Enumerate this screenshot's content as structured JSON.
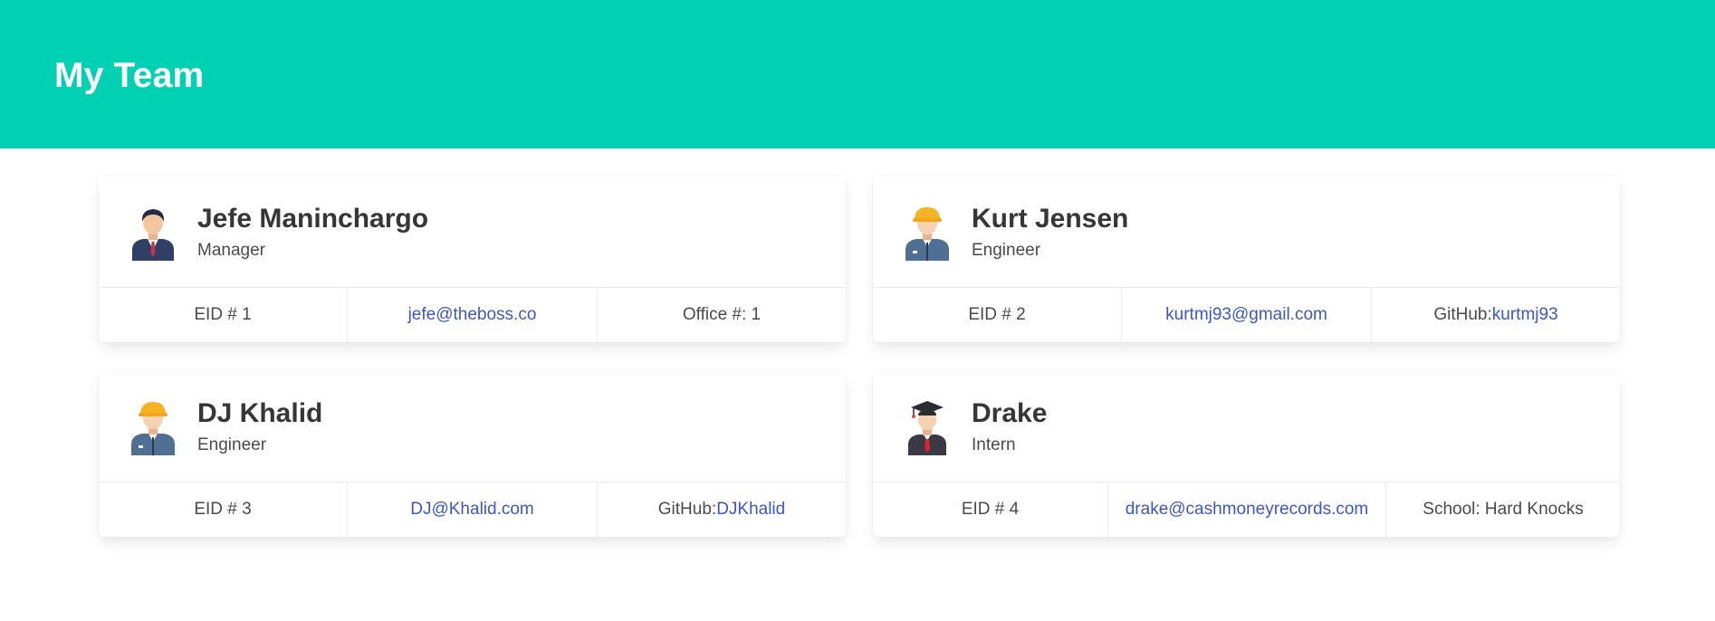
{
  "header": {
    "title": "My Team",
    "accent_color": "#00d1b2"
  },
  "link_color": "#3e56c4",
  "members": [
    {
      "name": "Jefe Maninchargo",
      "role": "Manager",
      "avatar_icon": "manager-avatar-icon",
      "eid": "EID # 1",
      "email": "jefe@theboss.co",
      "extra_prefix": "Office #: 1",
      "extra_link": ""
    },
    {
      "name": "Kurt Jensen",
      "role": "Engineer",
      "avatar_icon": "engineer-avatar-icon",
      "eid": "EID # 2",
      "email": "kurtmj93@gmail.com",
      "extra_prefix": "GitHub:",
      "extra_link": "kurtmj93"
    },
    {
      "name": "DJ Khalid",
      "role": "Engineer",
      "avatar_icon": "engineer-avatar-icon",
      "eid": "EID # 3",
      "email": "DJ@Khalid.com",
      "extra_prefix": "GitHub:",
      "extra_link": "DJKhalid"
    },
    {
      "name": "Drake",
      "role": "Intern",
      "avatar_icon": "intern-avatar-icon",
      "eid": "EID # 4",
      "email": "drake@cashmoneyrecords.com",
      "extra_prefix": "School: Hard Knocks",
      "extra_link": ""
    }
  ]
}
